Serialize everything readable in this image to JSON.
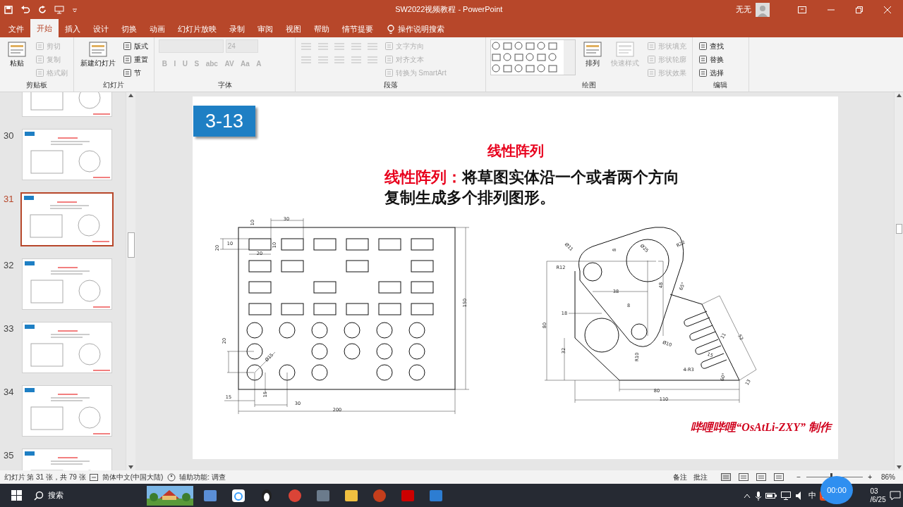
{
  "title_bar": {
    "title": "SW2022视频教程  -  PowerPoint",
    "user": "无无"
  },
  "tabs": [
    {
      "label": "文件",
      "selected": false
    },
    {
      "label": "开始",
      "selected": true
    },
    {
      "label": "插入",
      "selected": false
    },
    {
      "label": "设计",
      "selected": false
    },
    {
      "label": "切换",
      "selected": false
    },
    {
      "label": "动画",
      "selected": false
    },
    {
      "label": "幻灯片放映",
      "selected": false
    },
    {
      "label": "录制",
      "selected": false
    },
    {
      "label": "审阅",
      "selected": false
    },
    {
      "label": "视图",
      "selected": false
    },
    {
      "label": "帮助",
      "selected": false
    },
    {
      "label": "情节提要",
      "selected": false
    }
  ],
  "tell_me": "操作说明搜索",
  "ribbon": {
    "groups": [
      {
        "label": "剪贴板",
        "columns": [
          [
            {
              "kind": "large",
              "label": "粘贴",
              "disabled": false
            }
          ],
          [
            {
              "kind": "small",
              "label": "剪切",
              "disabled": true
            },
            {
              "kind": "small",
              "label": "复制",
              "disabled": true
            },
            {
              "kind": "small",
              "label": "格式刷",
              "disabled": true
            }
          ]
        ]
      },
      {
        "label": "幻灯片",
        "columns": [
          [
            {
              "kind": "large",
              "label": "新建幻灯片",
              "disabled": false
            }
          ],
          [
            {
              "kind": "small",
              "label": "版式",
              "disabled": false
            },
            {
              "kind": "small",
              "label": "重置",
              "disabled": false
            },
            {
              "kind": "small",
              "label": "节",
              "disabled": false
            }
          ]
        ]
      },
      {
        "label": "字体",
        "columns": [
          [
            {
              "kind": "size-field",
              "label": "24",
              "disabled": true
            },
            {
              "kind": "glyphs",
              "glyphs": [
                "B",
                "I",
                "U",
                "S",
                "abc",
                "AV",
                "Aa",
                "A"
              ],
              "disabled": true
            }
          ]
        ]
      },
      {
        "label": "段落",
        "columns": [
          [
            {
              "kind": "paragraph-icons",
              "disabled": true
            }
          ],
          [
            {
              "kind": "small",
              "label": "文字方向",
              "disabled": true
            },
            {
              "kind": "small",
              "label": "对齐文本",
              "disabled": true
            },
            {
              "kind": "small",
              "label": "转换为 SmartArt",
              "disabled": true
            }
          ]
        ]
      },
      {
        "label": "绘图",
        "columns": [
          [
            {
              "kind": "gallery",
              "disabled": false
            }
          ],
          [
            {
              "kind": "large",
              "label": "排列",
              "disabled": false
            }
          ],
          [
            {
              "kind": "large",
              "label": "快速样式",
              "disabled": true
            }
          ],
          [
            {
              "kind": "small",
              "label": "形状填充",
              "disabled": true
            },
            {
              "kind": "small",
              "label": "形状轮廓",
              "disabled": true
            },
            {
              "kind": "small",
              "label": "形状效果",
              "disabled": true
            }
          ]
        ]
      },
      {
        "label": "编辑",
        "columns": [
          [
            {
              "kind": "small",
              "label": "查找",
              "disabled": false
            },
            {
              "kind": "small",
              "label": "替换",
              "disabled": false
            },
            {
              "kind": "small",
              "label": "选择",
              "disabled": false
            }
          ]
        ]
      }
    ]
  },
  "thumbnails": [
    {
      "number": "30",
      "selected": false
    },
    {
      "number": "31",
      "selected": true
    },
    {
      "number": "32",
      "selected": false
    },
    {
      "number": "33",
      "selected": false
    },
    {
      "number": "34",
      "selected": false
    },
    {
      "number": "35",
      "selected": false
    }
  ],
  "slide": {
    "badge": "3-13",
    "title": "线性阵列",
    "term": "线性阵列：",
    "definition": "将草图实体沿一个或者两个方向复制生成多个排列图形。",
    "plate_dimensions": [
      "10",
      "30",
      "10",
      "10",
      "20",
      "20",
      "150",
      "20",
      "Ø15",
      "15",
      "15",
      "30",
      "200"
    ],
    "bracket_dimensions": [
      "Ø11",
      "R12",
      "8",
      "Ø25",
      "R22",
      "38",
      "48",
      "65°",
      "8",
      "18",
      "80",
      "32",
      "Ø10",
      "R10",
      "11",
      "15",
      "52",
      "4-R3",
      "60°",
      "13",
      "80",
      "110"
    ],
    "footer": "哔哩哔哩“OsAtLi-ZXY” 制作"
  },
  "status_bar": {
    "slide_info": "幻灯片 第 31 张，共 79 张",
    "language": "简体中文(中国大陆)",
    "accessibility": "辅助功能: 调查",
    "notes": "备注",
    "comments": "批注",
    "zoom_out": "−",
    "zoom_in": "+",
    "zoom": {
      "level": 0.45
    },
    "zoom_text": "86%"
  },
  "taskbar": {
    "search": "搜索",
    "ime": "中",
    "timer": "00:00",
    "clock_time": "03",
    "clock_date": "/6/25"
  }
}
